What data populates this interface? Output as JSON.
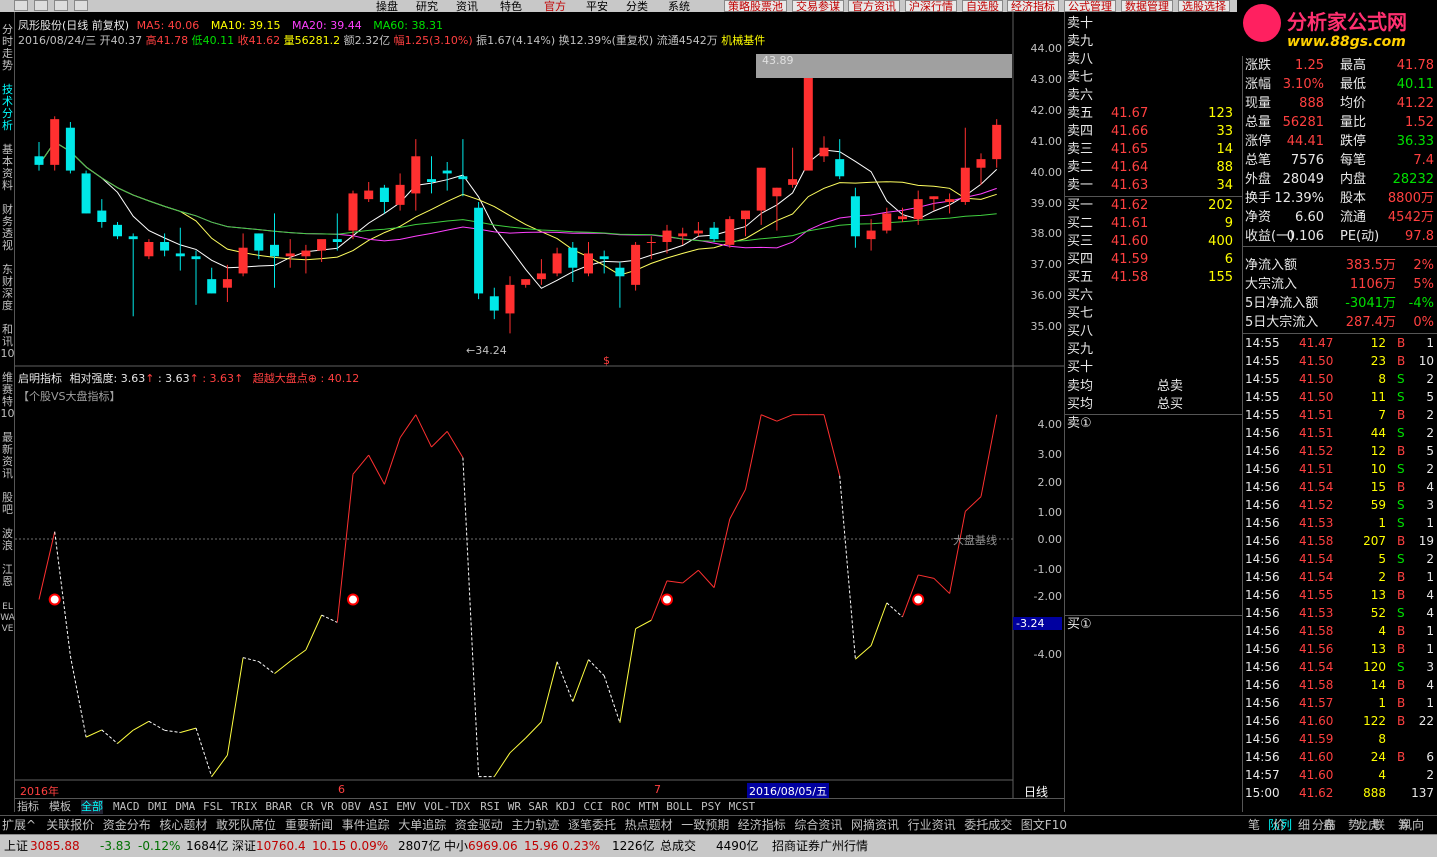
{
  "menu": {
    "items": [
      "操盘",
      "研究",
      "资讯",
      "特色",
      "官方",
      "平安",
      "分类",
      "系统"
    ],
    "tabs": [
      "策略股票池",
      "交易参谋",
      "官方资讯",
      "沪深行情",
      "自选股",
      "经济指标",
      "公式管理",
      "数据管理",
      "选股选择"
    ]
  },
  "logo": {
    "title": "分析家公式网",
    "url": "www.88gs.com"
  },
  "left_tabs": [
    "分时走势",
    "技术分析",
    "基本资料",
    "财务透视",
    "东财深度",
    "和讯10",
    "维赛特10",
    "最新资讯",
    "股吧",
    "波浪",
    "江恩",
    "ELWAVE"
  ],
  "header": {
    "name": "凤形股份(日线 前复权)",
    "ma5": "MA5: 40.06",
    "ma10": "MA10: 39.15",
    "ma20": "MA20: 39.44",
    "ma60": "MA60: 38.31",
    "date": "2016/08/24/三",
    "open": "开40.37",
    "high": "高41.78",
    "low": "低40.11",
    "close": "收41.62",
    "vol": "量56281.2",
    "amount": "额2.32亿",
    "range": "幅1.25(3.10%)",
    "amp": "振1.67(4.14%)",
    "turnover": "换12.39%(重复权)",
    "float": "流通4542万",
    "sector": "机械基件"
  },
  "indicator": {
    "name": "启明指标",
    "rel_label": "相对强度:",
    "v1": "3.63",
    "v2": ": 3.63",
    "v3": ": 3.63",
    "beat_label": "超越大盘点",
    "beat_val": ": 40.12",
    "subtitle": "【个股VS大盘指标】",
    "baseline_label": "大盘基线"
  },
  "price_axis": [
    "44.00",
    "43.00",
    "42.00",
    "41.00",
    "40.00",
    "39.00",
    "38.00",
    "37.00",
    "36.00",
    "35.00"
  ],
  "ind_axis": [
    "4.00",
    "3.00",
    "2.00",
    "1.00",
    "0.00",
    "-1.00",
    "-2.00",
    "-3.24",
    "-4.00"
  ],
  "chart_labels": {
    "max": "43.89",
    "min": "34.24",
    "dollar": "$"
  },
  "x_labels": [
    "2016年",
    "6",
    "7",
    "2016/08/05/五"
  ],
  "chart_data": {
    "type": "candlestick",
    "candles": [
      [
        40.5,
        41.0,
        40.0,
        40.2
      ],
      [
        40.2,
        41.9,
        40.0,
        41.8
      ],
      [
        41.5,
        41.7,
        39.9,
        40.0
      ],
      [
        39.9,
        40.0,
        38.5,
        38.5
      ],
      [
        38.6,
        39.0,
        38.0,
        38.2
      ],
      [
        38.1,
        38.2,
        37.6,
        37.7
      ],
      [
        37.7,
        37.8,
        34.9,
        37.6
      ],
      [
        37.0,
        37.6,
        36.9,
        37.5
      ],
      [
        37.5,
        37.8,
        37.0,
        37.2
      ],
      [
        37.1,
        38.0,
        36.5,
        37.0
      ],
      [
        37.0,
        37.2,
        35.3,
        36.9
      ],
      [
        36.2,
        36.6,
        35.7,
        35.7
      ],
      [
        35.9,
        36.7,
        35.4,
        36.2
      ],
      [
        36.4,
        37.8,
        36.3,
        37.3
      ],
      [
        37.8,
        37.8,
        36.9,
        37.2
      ],
      [
        37.4,
        38.5,
        35.9,
        37.0
      ],
      [
        37.0,
        37.6,
        36.6,
        37.1
      ],
      [
        37.0,
        37.4,
        36.4,
        37.2
      ],
      [
        37.2,
        37.4,
        36.8,
        37.6
      ],
      [
        37.6,
        38.5,
        37.2,
        37.5
      ],
      [
        37.9,
        39.3,
        37.6,
        39.2
      ],
      [
        39.0,
        39.6,
        38.9,
        39.3
      ],
      [
        39.4,
        39.5,
        38.5,
        38.9
      ],
      [
        38.8,
        39.9,
        38.6,
        39.5
      ],
      [
        39.2,
        41.1,
        38.6,
        40.5
      ],
      [
        39.7,
        40.5,
        39.2,
        39.6
      ],
      [
        40.0,
        40.3,
        39.3,
        39.9
      ],
      [
        39.8,
        41.1,
        39.1,
        39.7
      ],
      [
        38.7,
        38.9,
        35.5,
        35.7
      ],
      [
        35.6,
        35.9,
        34.8,
        35.1
      ],
      [
        35.0,
        36.3,
        34.3,
        36.0
      ],
      [
        36.0,
        36.2,
        35.9,
        36.2
      ],
      [
        36.2,
        36.9,
        36.0,
        36.4
      ],
      [
        36.4,
        37.3,
        36.3,
        37.1
      ],
      [
        37.3,
        37.5,
        36.1,
        36.6
      ],
      [
        36.4,
        37.5,
        36.3,
        37.1
      ],
      [
        37.0,
        37.2,
        36.4,
        36.9
      ],
      [
        36.6,
        36.8,
        35.2,
        36.3
      ],
      [
        36.0,
        37.5,
        35.8,
        37.4
      ],
      [
        37.5,
        37.7,
        36.9,
        37.5
      ],
      [
        37.5,
        38.1,
        37.1,
        37.9
      ],
      [
        37.7,
        38.0,
        37.4,
        37.8
      ],
      [
        37.8,
        38.2,
        37.7,
        37.9
      ],
      [
        38.0,
        38.2,
        37.5,
        37.6
      ],
      [
        37.4,
        38.4,
        37.3,
        38.3
      ],
      [
        38.3,
        38.6,
        37.7,
        38.6
      ],
      [
        38.6,
        40.1,
        38.1,
        40.1
      ],
      [
        39.1,
        39.4,
        37.9,
        39.4
      ],
      [
        39.5,
        40.8,
        39.4,
        39.7
      ],
      [
        40.0,
        43.9,
        40.1,
        43.6
      ],
      [
        40.5,
        41.2,
        40.3,
        40.8
      ],
      [
        40.4,
        41.1,
        39.7,
        39.8
      ],
      [
        39.1,
        39.4,
        37.3,
        37.7
      ],
      [
        37.6,
        38.3,
        37.2,
        37.9
      ],
      [
        37.9,
        38.7,
        37.8,
        38.5
      ],
      [
        38.3,
        38.7,
        38.2,
        38.4
      ],
      [
        38.3,
        39.3,
        38.1,
        39.0
      ],
      [
        39.0,
        39.1,
        38.6,
        39.1
      ],
      [
        38.9,
        39.2,
        38.5,
        39.0
      ],
      [
        38.9,
        41.5,
        38.8,
        40.1
      ],
      [
        40.1,
        40.6,
        39.5,
        40.4
      ],
      [
        40.4,
        41.8,
        40.1,
        41.6
      ]
    ],
    "ylim": [
      34.0,
      44.5
    ],
    "ind_ylim": [
      -5.0,
      5.0
    ]
  },
  "orderbook": {
    "sell": [
      {
        "label": "卖十",
        "price": "",
        "vol": ""
      },
      {
        "label": "卖九",
        "price": "",
        "vol": ""
      },
      {
        "label": "卖八",
        "price": "",
        "vol": ""
      },
      {
        "label": "卖七",
        "price": "",
        "vol": ""
      },
      {
        "label": "卖六",
        "price": "",
        "vol": ""
      },
      {
        "label": "卖五",
        "price": "41.67",
        "vol": "123"
      },
      {
        "label": "卖四",
        "price": "41.66",
        "vol": "33"
      },
      {
        "label": "卖三",
        "price": "41.65",
        "vol": "14"
      },
      {
        "label": "卖二",
        "price": "41.64",
        "vol": "88"
      },
      {
        "label": "卖一",
        "price": "41.63",
        "vol": "34"
      }
    ],
    "buy": [
      {
        "label": "买一",
        "price": "41.62",
        "vol": "202"
      },
      {
        "label": "买二",
        "price": "41.61",
        "vol": "9"
      },
      {
        "label": "买三",
        "price": "41.60",
        "vol": "400"
      },
      {
        "label": "买四",
        "price": "41.59",
        "vol": "6"
      },
      {
        "label": "买五",
        "price": "41.58",
        "vol": "155"
      },
      {
        "label": "买六",
        "price": "",
        "vol": ""
      },
      {
        "label": "买七",
        "price": "",
        "vol": ""
      },
      {
        "label": "买八",
        "price": "",
        "vol": ""
      },
      {
        "label": "买九",
        "price": "",
        "vol": ""
      },
      {
        "label": "买十",
        "price": "",
        "vol": ""
      }
    ],
    "avg_sell": "卖均",
    "total_sell": "总卖",
    "avg_buy": "买均",
    "total_buy": "总买",
    "sell1_mark": "卖①",
    "buy1_mark": "买①"
  },
  "stats": [
    [
      "涨跌",
      "1.25",
      "最高",
      "41.78"
    ],
    [
      "涨幅",
      "3.10%",
      "最低",
      "40.11"
    ],
    [
      "现量",
      "888",
      "均价",
      "41.22"
    ],
    [
      "总量",
      "56281",
      "量比",
      "1.52"
    ],
    [
      "涨停",
      "44.41",
      "跌停",
      "36.33"
    ],
    [
      "总笔",
      "7576",
      "每笔",
      "7.4"
    ],
    [
      "外盘",
      "28049",
      "内盘",
      "28232"
    ],
    [
      "换手",
      "12.39%",
      "股本",
      "8800万"
    ],
    [
      "净资",
      "6.60",
      "流通",
      "4542万"
    ],
    [
      "收益(一)",
      "0.106",
      "PE(动)",
      "97.8"
    ]
  ],
  "flows": [
    [
      "净流入额",
      "383.5万",
      "2%"
    ],
    [
      "大宗流入",
      "1106万",
      "5%"
    ],
    [
      "5日净流入额",
      "-3041万",
      "-4%"
    ],
    [
      "5日大宗流入",
      "287.4万",
      "0%"
    ]
  ],
  "ticks": [
    [
      "14:55",
      "41.47",
      "12",
      "B",
      "1"
    ],
    [
      "14:55",
      "41.50",
      "23",
      "B",
      "10"
    ],
    [
      "14:55",
      "41.50",
      "8",
      "S",
      "2"
    ],
    [
      "14:55",
      "41.50",
      "11",
      "S",
      "5"
    ],
    [
      "14:55",
      "41.51",
      "7",
      "B",
      "2"
    ],
    [
      "14:56",
      "41.51",
      "44",
      "S",
      "2"
    ],
    [
      "14:56",
      "41.52",
      "12",
      "B",
      "5"
    ],
    [
      "14:56",
      "41.51",
      "10",
      "S",
      "2"
    ],
    [
      "14:56",
      "41.54",
      "15",
      "B",
      "4"
    ],
    [
      "14:56",
      "41.52",
      "59",
      "S",
      "3"
    ],
    [
      "14:56",
      "41.53",
      "1",
      "S",
      "1"
    ],
    [
      "14:56",
      "41.58",
      "207",
      "B",
      "19"
    ],
    [
      "14:56",
      "41.54",
      "5",
      "S",
      "2"
    ],
    [
      "14:56",
      "41.54",
      "2",
      "B",
      "1"
    ],
    [
      "14:56",
      "41.55",
      "13",
      "B",
      "4"
    ],
    [
      "14:56",
      "41.53",
      "52",
      "S",
      "4"
    ],
    [
      "14:56",
      "41.58",
      "4",
      "B",
      "1"
    ],
    [
      "14:56",
      "41.56",
      "13",
      "B",
      "1"
    ],
    [
      "14:56",
      "41.54",
      "120",
      "S",
      "3"
    ],
    [
      "14:56",
      "41.58",
      "14",
      "B",
      "4"
    ],
    [
      "14:56",
      "41.57",
      "1",
      "B",
      "1"
    ],
    [
      "14:56",
      "41.60",
      "122",
      "B",
      "22"
    ],
    [
      "14:56",
      "41.59",
      "8",
      "",
      ""
    ],
    [
      "14:56",
      "41.60",
      "24",
      "B",
      "6"
    ],
    [
      "14:57",
      "41.60",
      "4",
      "",
      "2"
    ],
    [
      "15:00",
      "41.62",
      "888",
      "",
      "137"
    ]
  ],
  "bottom_tabs": [
    "指标",
    "模板",
    "全部",
    "MACD",
    "DMI",
    "DMA",
    "FSL",
    "TRIX",
    "BRAR",
    "CR",
    "VR",
    "OBV",
    "ASI",
    "EMV",
    "VOL-TDX",
    "RSI",
    "WR",
    "SAR",
    "KDJ",
    "CCI",
    "ROC",
    "MTM",
    "BOLL",
    "PSY",
    "MCST"
  ],
  "period": "日线",
  "funcbar": [
    "扩展^",
    "关联报价",
    "资金分布",
    "核心题材",
    "敢死队席位",
    "重要新闻",
    "事件追踪",
    "大单追踪",
    "资金驱动",
    "主力轨迹",
    "逐笔委托",
    "热点题材",
    "一致预期",
    "经济指标",
    "综合资讯",
    "网摘资讯",
    "行业资讯",
    "委托成交",
    "图文F10"
  ],
  "right_tabs": [
    "队列",
    "分布",
    "龙虎",
    "风向"
  ],
  "small_tabs": [
    "笔",
    "价",
    "细",
    "盘",
    "势",
    "联",
    "筹"
  ],
  "statusbar": {
    "sh_label": "上证",
    "sh_val": "3085.88",
    "sh_chg": "-3.83",
    "sh_pct": "-0.12%",
    "sh_amt": "1684亿",
    "sz_label": "深证",
    "sz_val": "10760.4",
    "sz_chg": "10.15",
    "sz_pct": "0.09%",
    "sz_amt": "2807亿",
    "zx_label": "中小",
    "zx_val": "6969.06",
    "zx_chg": "15.96",
    "zx_pct": "0.23%",
    "zx_amt": "1226亿",
    "total_label": "总成交",
    "total_amt": "4490亿",
    "broker": "招商证券广州行情"
  }
}
